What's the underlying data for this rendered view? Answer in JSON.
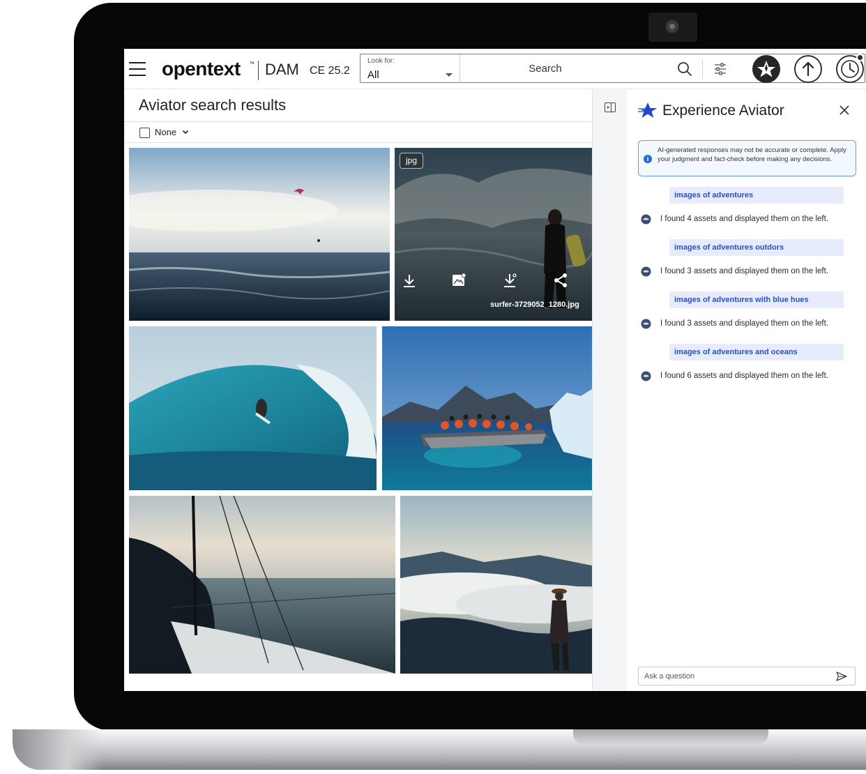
{
  "header": {
    "menu_icon": "hamburger-menu-icon",
    "brand": "opentext",
    "brand_tm": "™",
    "app_name": "DAM",
    "version": "CE 25.2",
    "look_for_label": "Look for:",
    "look_for_value": "All",
    "search_placeholder": "Search",
    "icons": [
      "search-icon",
      "filter-settings-icon",
      "aviator-icon",
      "upload-icon",
      "recent-history-icon"
    ]
  },
  "results": {
    "title": "Aviator search results",
    "selection_label": "None",
    "hovered_item": {
      "type_badge": "jpg",
      "filename": "surfer-3729052_1280.jpg",
      "actions": [
        "download-icon",
        "image-preview-icon",
        "download-renditions-icon",
        "share-icon"
      ]
    },
    "photos": [
      "kite-surfing-ocean",
      "surfer-in-water",
      "surfer-in-wave",
      "rib-boat-icebergs",
      "sailboat-at-sea",
      "hiker-above-clouds"
    ]
  },
  "aviator": {
    "title": "Experience Aviator",
    "disclaimer": "AI-generated responses may not be accurate or complete. Apply your judgment and fact-check before making any decisions.",
    "conversation": [
      {
        "query": "images of adventures",
        "reply": "I found 4 assets and displayed them on the left."
      },
      {
        "query": "images of adventures outdors",
        "reply": "I found 3 assets and displayed them on the left."
      },
      {
        "query": "images of adventures with blue hues",
        "reply": "I found 3 assets and displayed them on the left."
      },
      {
        "query": "images of adventures and oceans",
        "reply": "I found 6 assets and displayed them on the left."
      }
    ],
    "ask_placeholder": "Ask a question"
  },
  "colors": {
    "accent_blue": "#2a4dd0",
    "query_bg": "#e6ecfb",
    "disclaimer_border": "#5e9ce6"
  }
}
